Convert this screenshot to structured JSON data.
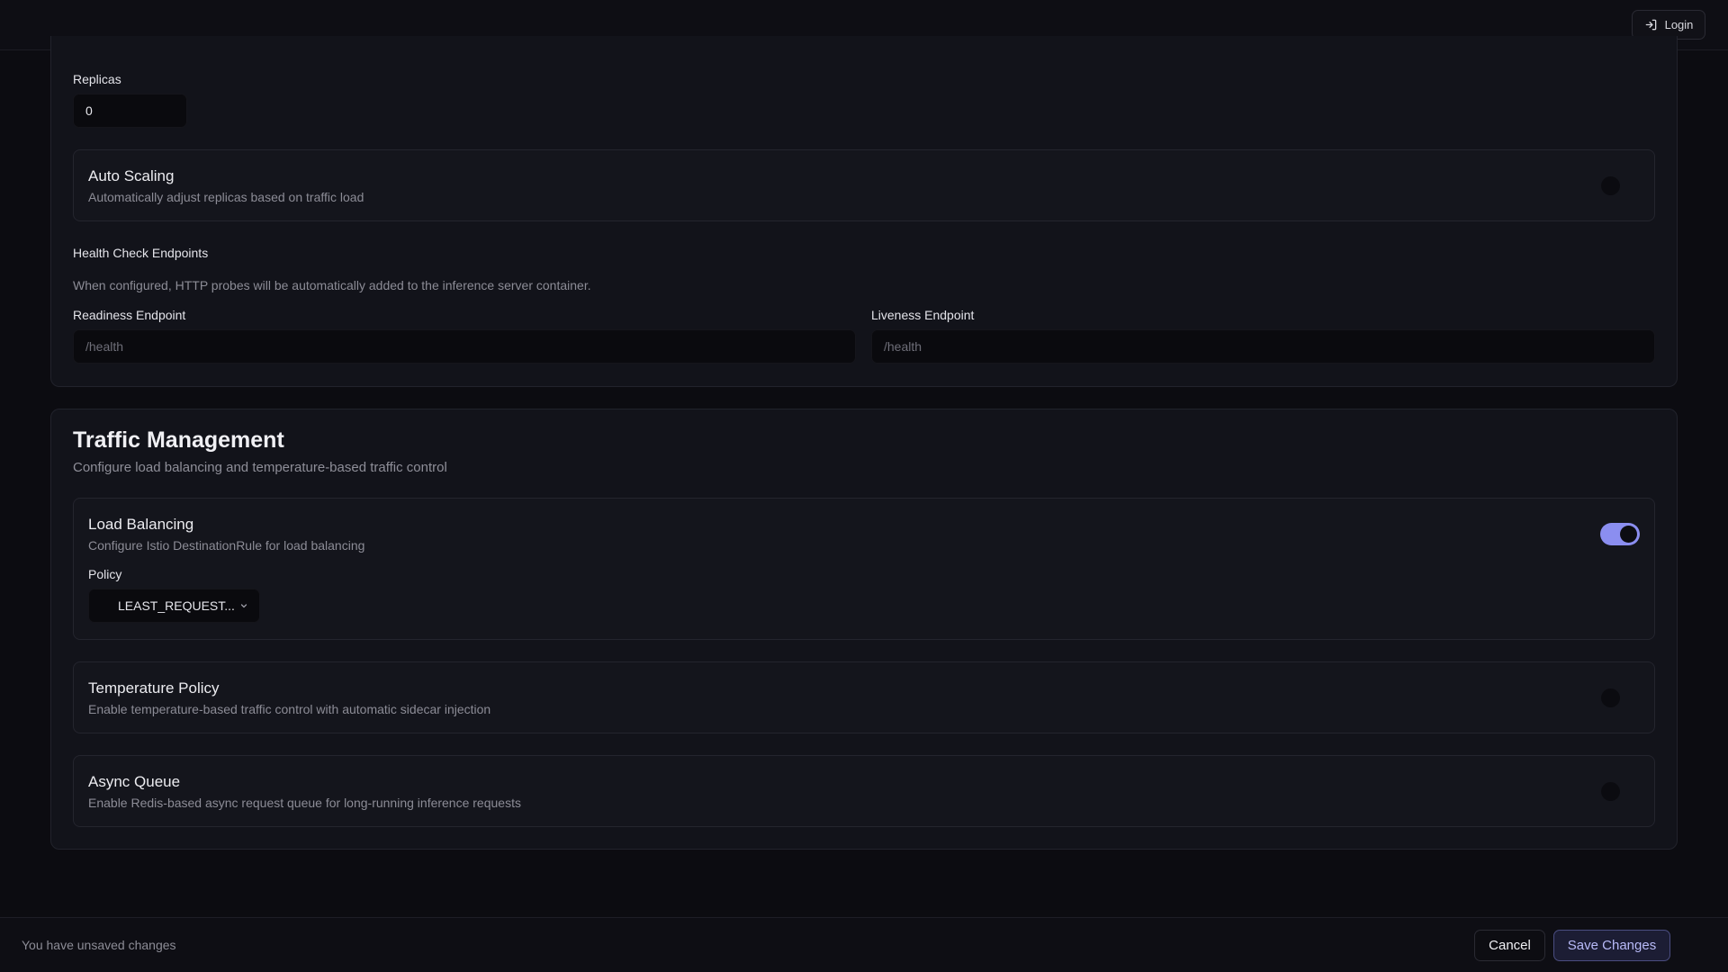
{
  "header": {
    "login_label": "Login"
  },
  "deployment": {
    "replicas_label": "Replicas",
    "replicas_value": "0",
    "auto_scaling": {
      "title": "Auto Scaling",
      "description": "Automatically adjust replicas based on traffic load",
      "enabled": false
    },
    "health_check": {
      "title": "Health Check Endpoints",
      "note": "When configured, HTTP probes will be automatically added to the inference server container.",
      "readiness_label": "Readiness Endpoint",
      "readiness_placeholder": "/health",
      "liveness_label": "Liveness Endpoint",
      "liveness_placeholder": "/health"
    }
  },
  "traffic": {
    "title": "Traffic Management",
    "description": "Configure load balancing and temperature-based traffic control",
    "load_balancing": {
      "title": "Load Balancing",
      "description": "Configure Istio DestinationRule for load balancing",
      "enabled": true,
      "policy_label": "Policy",
      "policy_value": "LEAST_REQUEST..."
    },
    "temperature_policy": {
      "title": "Temperature Policy",
      "description": "Enable temperature-based traffic control with automatic sidecar injection",
      "enabled": false
    },
    "async_queue": {
      "title": "Async Queue",
      "description": "Enable Redis-based async request queue for long-running inference requests",
      "enabled": false
    }
  },
  "footer": {
    "status": "You have unsaved changes",
    "cancel_label": "Cancel",
    "save_label": "Save Changes"
  },
  "colors": {
    "accent": "#8b8ef0",
    "background": "#0c0c11",
    "card": "#12131a"
  }
}
